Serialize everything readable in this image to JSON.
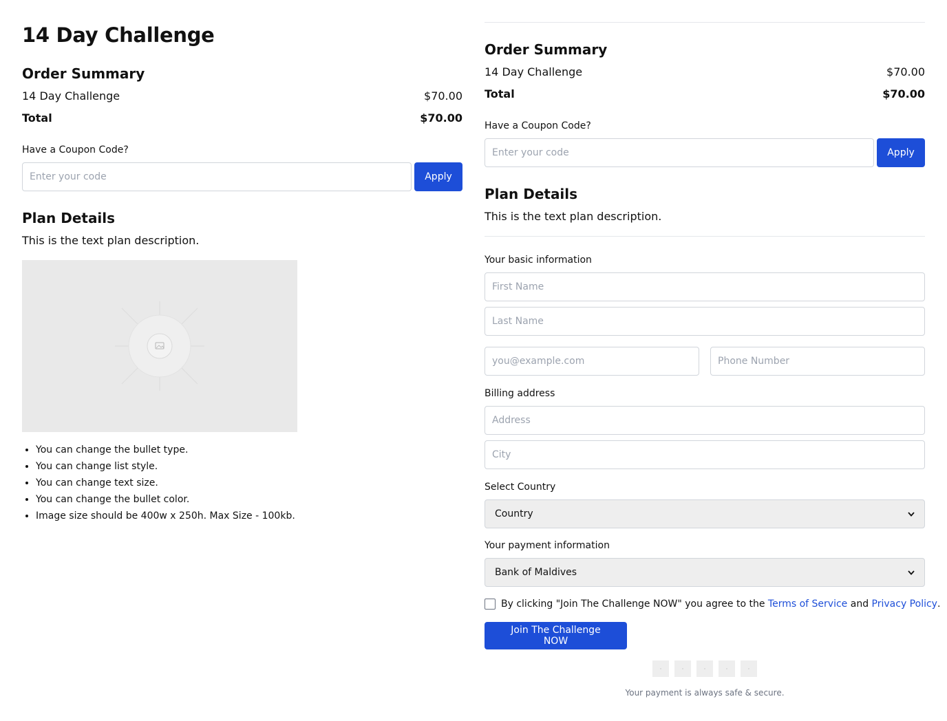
{
  "page": {
    "title": "14 Day Challenge"
  },
  "order_summary": {
    "heading": "Order Summary",
    "item_name": "14 Day Challenge",
    "item_price": "$70.00",
    "total_label": "Total",
    "total_price": "$70.00"
  },
  "coupon": {
    "label": "Have a Coupon Code?",
    "placeholder": "Enter your code",
    "apply_label": "Apply"
  },
  "plan": {
    "heading": "Plan Details",
    "description": "This is the text plan description.",
    "bullets": [
      "You can change the bullet type.",
      "You can change list style.",
      "You can change text size.",
      "You can change the bullet color.",
      "Image size should be 400w x 250h. Max Size - 100kb."
    ]
  },
  "form": {
    "basic_info_label": "Your basic information",
    "first_name_placeholder": "First Name",
    "last_name_placeholder": "Last Name",
    "email_placeholder": "you@example.com",
    "phone_placeholder": "Phone Number",
    "billing_label": "Billing address",
    "address_placeholder": "Address",
    "city_placeholder": "City",
    "country_label": "Select Country",
    "country_value": "Country",
    "payment_label": "Your payment information",
    "payment_value": "Bank of Maldives",
    "agree_text": "By clicking \"Join The Challenge NOW\" you agree to the ",
    "terms_link": "Terms of Service",
    "and_text": " and ",
    "privacy_link": "Privacy Policy",
    "period": ".",
    "submit_label": "Join The Challenge NOW",
    "secure_text": "Your payment is always safe & secure."
  },
  "colors": {
    "accent": "#1d4ed8",
    "placeholder_image_bg": "#e9e9e9"
  }
}
